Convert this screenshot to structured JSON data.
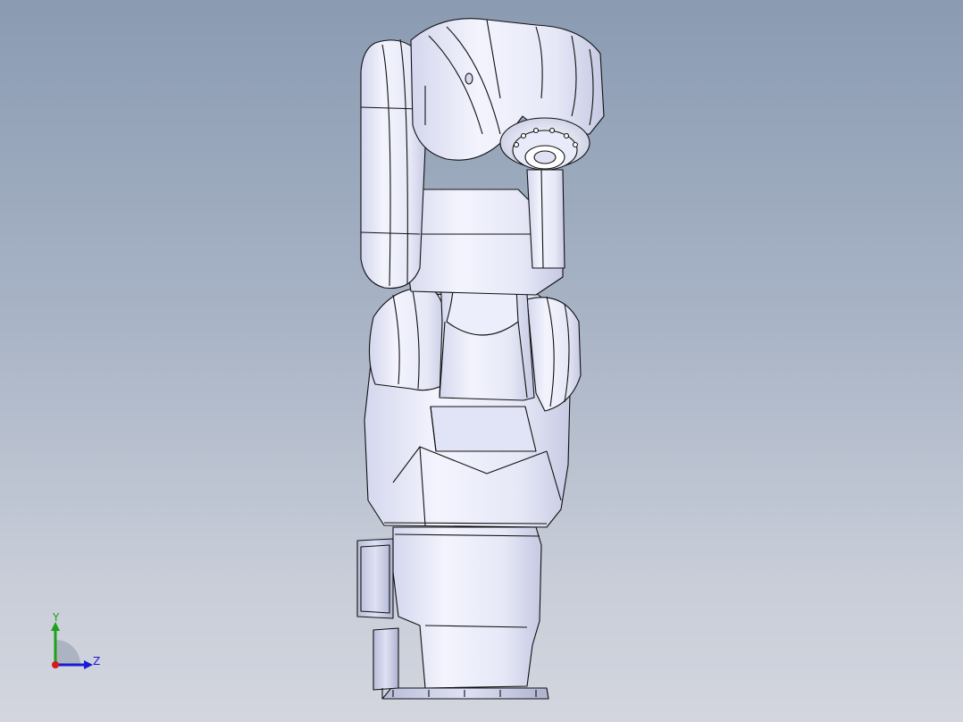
{
  "view": {
    "background_top": "#8a9bb2",
    "background_bottom": "#d3d6de",
    "model_fill": "#eef0fb",
    "model_shadow": "#c9cde6",
    "edge_color": "#111111"
  },
  "triad": {
    "y_label": "Y",
    "z_label": "Z",
    "y_color": "#1aa21a",
    "z_color": "#1a1ad6",
    "x_color": "#d41a1a"
  }
}
